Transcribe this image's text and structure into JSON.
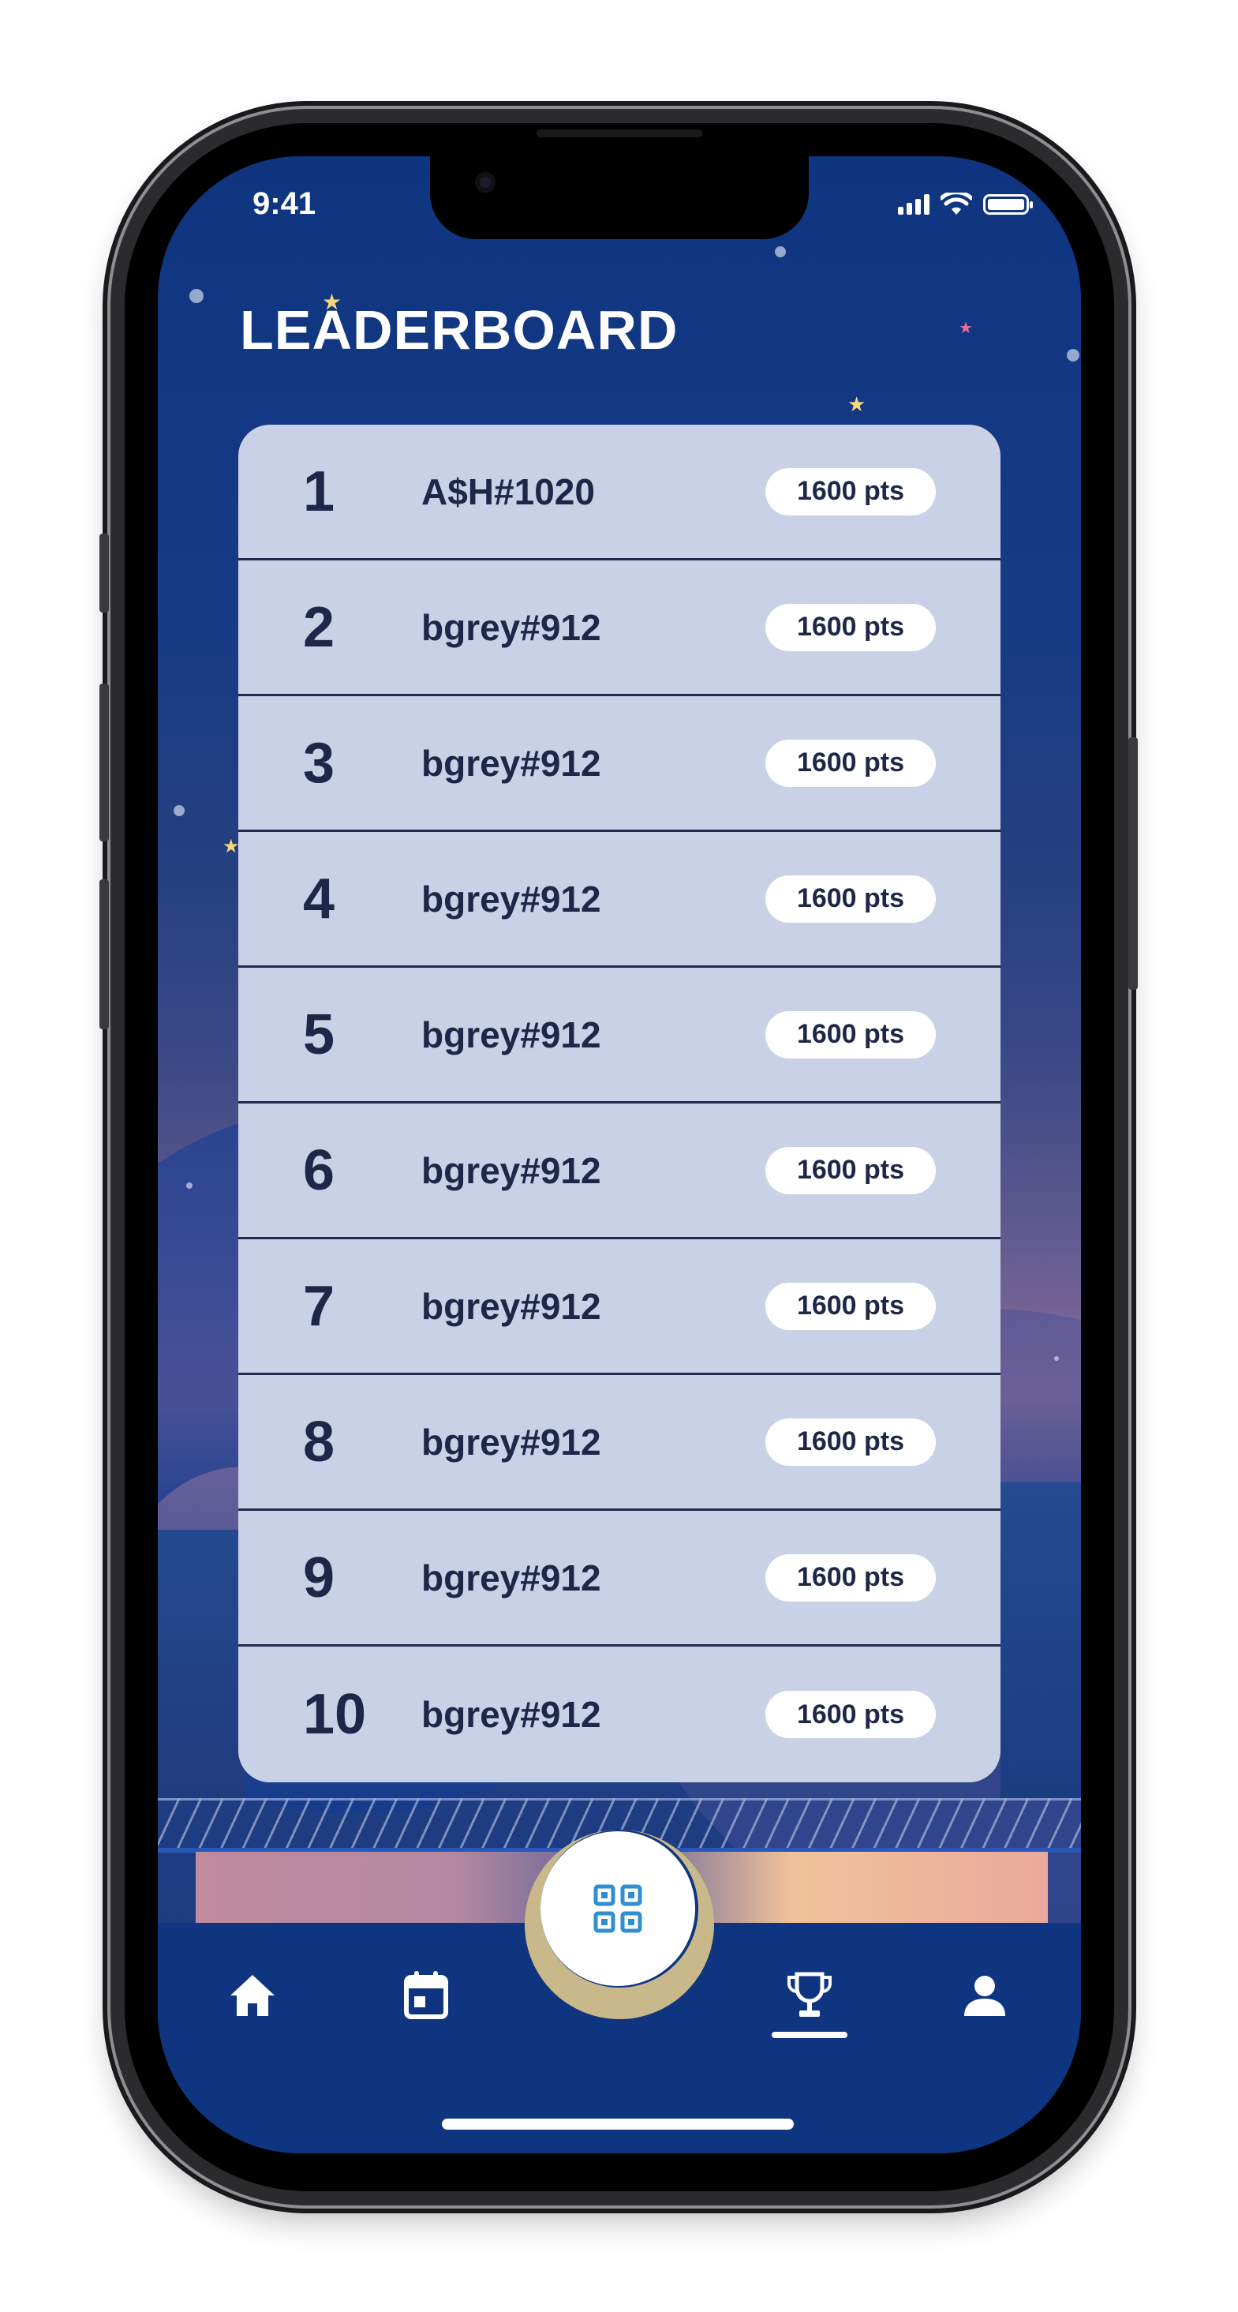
{
  "status_bar": {
    "time": "9:41"
  },
  "header": {
    "title": "LEADERBOARD"
  },
  "leaderboard": [
    {
      "rank": "1",
      "username": "A$H#1020",
      "points": "1600 pts"
    },
    {
      "rank": "2",
      "username": "bgrey#912",
      "points": "1600 pts"
    },
    {
      "rank": "3",
      "username": "bgrey#912",
      "points": "1600 pts"
    },
    {
      "rank": "4",
      "username": "bgrey#912",
      "points": "1600 pts"
    },
    {
      "rank": "5",
      "username": "bgrey#912",
      "points": "1600 pts"
    },
    {
      "rank": "6",
      "username": "bgrey#912",
      "points": "1600 pts"
    },
    {
      "rank": "7",
      "username": "bgrey#912",
      "points": "1600 pts"
    },
    {
      "rank": "8",
      "username": "bgrey#912",
      "points": "1600 pts"
    },
    {
      "rank": "9",
      "username": "bgrey#912",
      "points": "1600 pts"
    },
    {
      "rank": "10",
      "username": "bgrey#912",
      "points": "1600 pts"
    }
  ],
  "bottom_nav": {
    "items": [
      {
        "icon": "home-icon"
      },
      {
        "icon": "calendar-icon"
      },
      {
        "icon": "qr-code-icon"
      },
      {
        "icon": "trophy-icon",
        "active": true
      },
      {
        "icon": "profile-icon"
      }
    ]
  },
  "colors": {
    "background": "#0f3580",
    "card": "#c9d1e6",
    "text_dark": "#1d2747",
    "pill": "#ffffff",
    "accent_gold": "#c9b98a",
    "qr_blue": "#2f8fd0"
  }
}
